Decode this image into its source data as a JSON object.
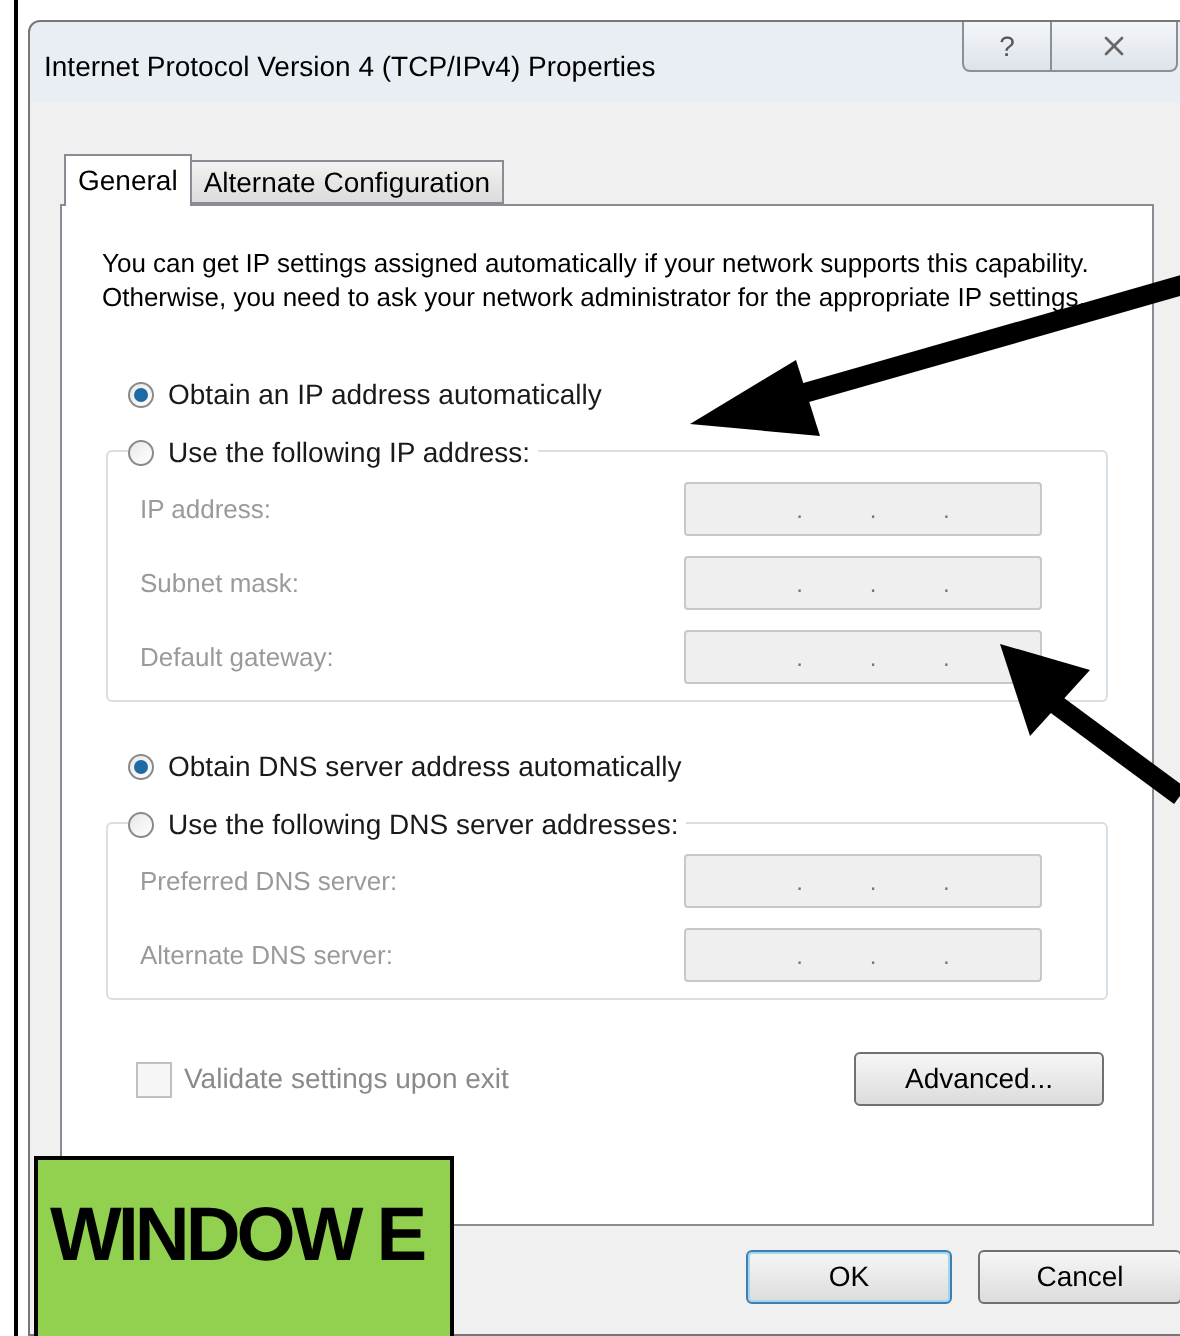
{
  "window": {
    "title": "Internet Protocol Version 4 (TCP/IPv4) Properties",
    "help": "?"
  },
  "tabs": [
    {
      "label": "General",
      "selected": true
    },
    {
      "label": "Alternate Configuration",
      "selected": false
    }
  ],
  "description": "You can get IP settings assigned automatically if your network supports this capability. Otherwise, you need to ask your network administrator for the appropriate IP settings.",
  "ip_section": {
    "options": [
      {
        "label": "Obtain an IP address automatically",
        "selected": true
      },
      {
        "label": "Use the following IP address:",
        "selected": false
      }
    ],
    "fields_enabled": false,
    "fields": [
      {
        "label": "IP address:",
        "value": ". . ."
      },
      {
        "label": "Subnet mask:",
        "value": ". . ."
      },
      {
        "label": "Default gateway:",
        "value": ". . ."
      }
    ]
  },
  "dns_section": {
    "options": [
      {
        "label": "Obtain DNS server address automatically",
        "selected": true
      },
      {
        "label": "Use the following DNS server addresses:",
        "selected": false
      }
    ],
    "fields_enabled": false,
    "fields": [
      {
        "label": "Preferred DNS server:",
        "value": ". . ."
      },
      {
        "label": "Alternate DNS server:",
        "value": ". . ."
      }
    ]
  },
  "validate": {
    "label": "Validate settings upon exit",
    "checked": false,
    "disabled": true
  },
  "buttons": [
    {
      "label": "Advanced...",
      "default": false
    },
    {
      "label": "OK",
      "default": true
    },
    {
      "label": "Cancel",
      "default": false
    }
  ],
  "annotation": {
    "label": "WINDOW E"
  }
}
